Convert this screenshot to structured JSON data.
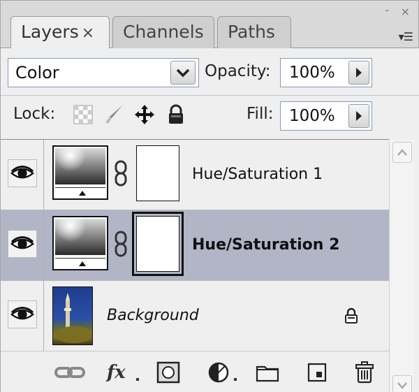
{
  "tabs": [
    {
      "label": "Layers",
      "close": "×",
      "active": true
    },
    {
      "label": "Channels",
      "active": false
    },
    {
      "label": "Paths",
      "active": false
    }
  ],
  "window_controls": {
    "minimize": "-",
    "close": "×"
  },
  "panel_menu": "▾☰",
  "blend_mode": {
    "value": "Color"
  },
  "opacity": {
    "label": "Opacity:",
    "value": "100%"
  },
  "lock": {
    "label": "Lock:",
    "icons": [
      "lock-transparent-icon",
      "lock-image-icon",
      "lock-position-icon",
      "lock-all-icon"
    ]
  },
  "fill": {
    "label": "Fill:",
    "value": "100%"
  },
  "layers": [
    {
      "name": "Hue/Saturation 1",
      "visible": true,
      "selected": false,
      "type": "adjustment"
    },
    {
      "name": "Hue/Saturation 2",
      "visible": true,
      "selected": true,
      "type": "adjustment"
    },
    {
      "name": "Background",
      "visible": true,
      "selected": false,
      "type": "image",
      "locked": true
    }
  ],
  "bottom_icons": [
    "link-layers-icon",
    "fx-icon",
    "add-mask-icon",
    "adjustment-layer-icon",
    "new-group-icon",
    "new-layer-icon",
    "delete-layer-icon"
  ],
  "colors": {
    "selected_row": "#b1b5c6",
    "panel_bg": "#efefef",
    "field_border": "#7f9db9"
  }
}
